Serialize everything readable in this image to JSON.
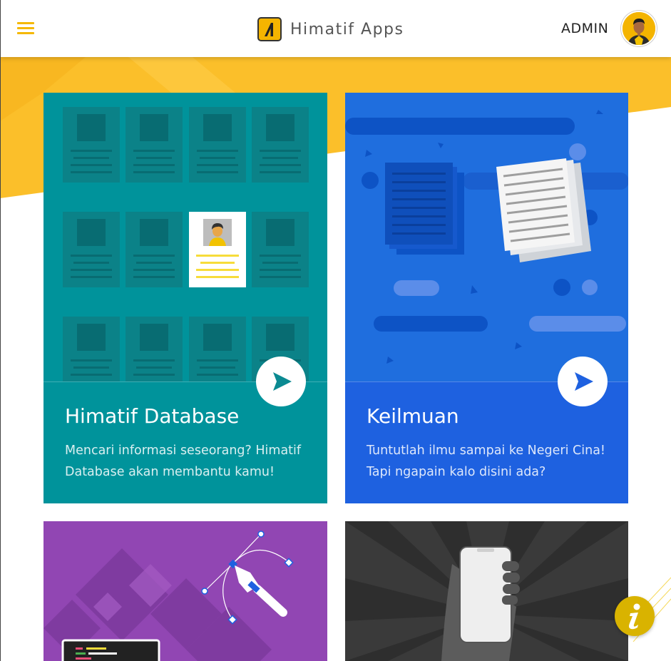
{
  "header": {
    "menu_icon": "hamburger-menu-icon",
    "app_title": "Himatif Apps",
    "user_name": "ADMIN"
  },
  "cards": [
    {
      "title": "Himatif Database",
      "description": "Mencari informasi seseorang? Himatif Database akan membantu kamu!",
      "color": "#00939b"
    },
    {
      "title": "Keilmuan",
      "description": "Tuntutlah ilmu sampai ke Negeri Cina! Tapi ngapain kalo disini ada?",
      "color": "#1e61e0"
    },
    {
      "title": "",
      "description": "",
      "color": "#8e44ad"
    },
    {
      "title": "",
      "description": "",
      "color": "#3d3d3d"
    }
  ],
  "colors": {
    "accent": "#f5b800",
    "info_button": "#d9b300"
  },
  "info_icon": "info-icon"
}
